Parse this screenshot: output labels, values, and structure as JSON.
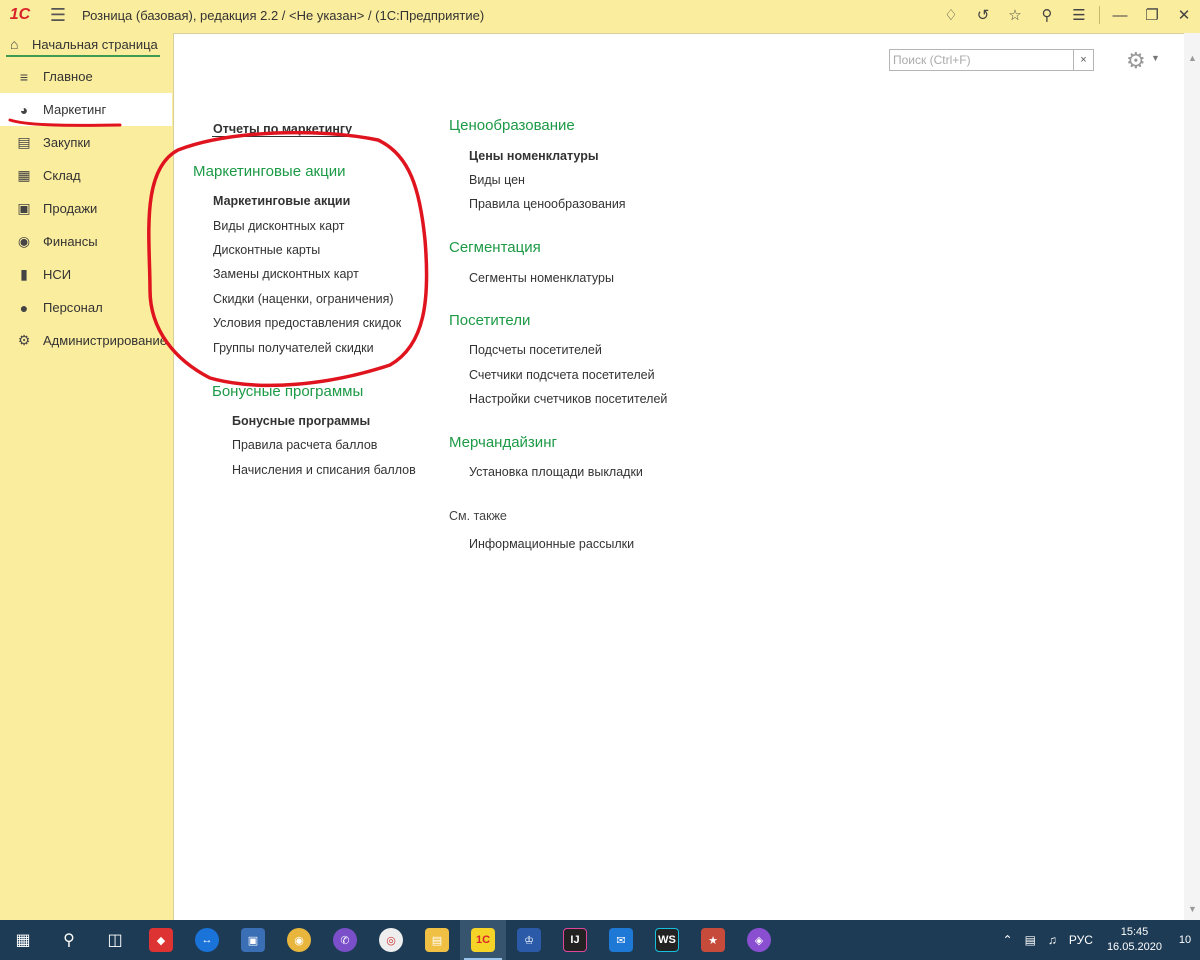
{
  "window": {
    "logo": "1С",
    "title": "Розница (базовая), редакция 2.2 / <Не указан> /  (1С:Предприятие)"
  },
  "home_tab": {
    "label": "Начальная страница"
  },
  "sidebar": {
    "items": [
      {
        "label": "Главное",
        "icon": "menu-lines-icon"
      },
      {
        "label": "Маркетинг",
        "icon": "pie-chart-icon"
      },
      {
        "label": "Закупки",
        "icon": "cart-icon"
      },
      {
        "label": "Склад",
        "icon": "warehouse-icon"
      },
      {
        "label": "Продажи",
        "icon": "basket-icon"
      },
      {
        "label": "Финансы",
        "icon": "coin-icon"
      },
      {
        "label": "НСИ",
        "icon": "book-icon"
      },
      {
        "label": "Персонал",
        "icon": "person-icon"
      },
      {
        "label": "Администрирование",
        "icon": "gear-icon"
      }
    ]
  },
  "search": {
    "placeholder": "Поиск (Ctrl+F)",
    "value": "",
    "clear": "×"
  },
  "main": {
    "reports_link": "Отчеты по маркетингу",
    "marketing_actions": {
      "title": "Маркетинговые акции",
      "links": [
        "Маркетинговые акции",
        "Виды дисконтных карт",
        "Дисконтные карты",
        "Замены дисконтных карт",
        "Скидки (наценки, ограничения)",
        "Условия предоставления скидок",
        "Группы получателей скидки"
      ]
    },
    "bonus_programs": {
      "title": "Бонусные программы",
      "links": [
        "Бонусные программы",
        "Правила расчета баллов",
        "Начисления и списания баллов"
      ]
    },
    "pricing": {
      "title": "Ценообразование",
      "links": [
        "Цены номенклатуры",
        "Виды цен",
        "Правила ценообразования"
      ]
    },
    "segmentation": {
      "title": "Сегментация",
      "links": [
        "Сегменты номенклатуры"
      ]
    },
    "visitors": {
      "title": "Посетители",
      "links": [
        "Подсчеты посетителей",
        "Счетчики подсчета посетителей",
        "Настройки счетчиков посетителей"
      ]
    },
    "merchandising": {
      "title": "Мерчандайзинг",
      "links": [
        "Установка площади выкладки"
      ]
    },
    "see_also": {
      "title": "См. также",
      "links": [
        "Информационные рассылки"
      ]
    }
  },
  "taskbar": {
    "tray_lang": "РУС",
    "time": "15:45",
    "date": "16.05.2020",
    "notifications": "10"
  },
  "colors": {
    "sidebar_bg": "#fbed9e",
    "group_title": "#1c9a46",
    "annotation_red": "#e0141e",
    "taskbar_bg": "#1d3b55"
  }
}
